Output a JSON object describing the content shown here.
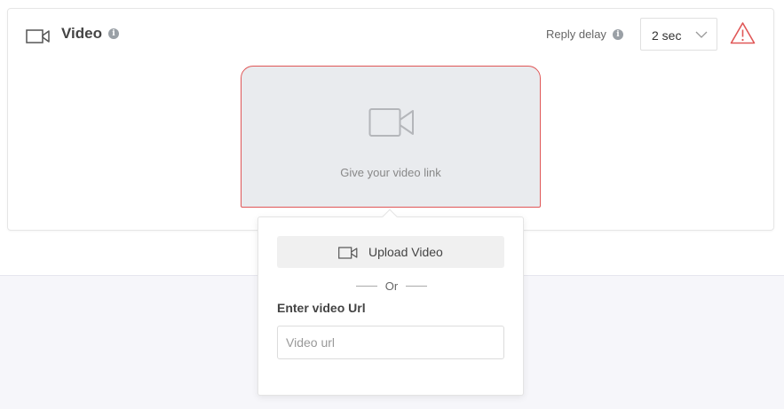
{
  "card": {
    "title": "Video",
    "title_icon": "video-camera-icon",
    "info_icon": "info-icon",
    "reply_delay_label": "Reply delay",
    "reply_delay_value": "2 sec",
    "warning_icon": "warning-triangle-icon",
    "warning_color": "#e05757"
  },
  "video_box": {
    "icon": "video-camera-icon",
    "placeholder_text": "Give your video link",
    "border_color": "#e05757"
  },
  "popover": {
    "upload_button_label": "Upload Video",
    "upload_icon": "video-camera-icon",
    "or_text": "Or",
    "url_label": "Enter video Url",
    "url_value": "",
    "url_placeholder": "Video url"
  }
}
